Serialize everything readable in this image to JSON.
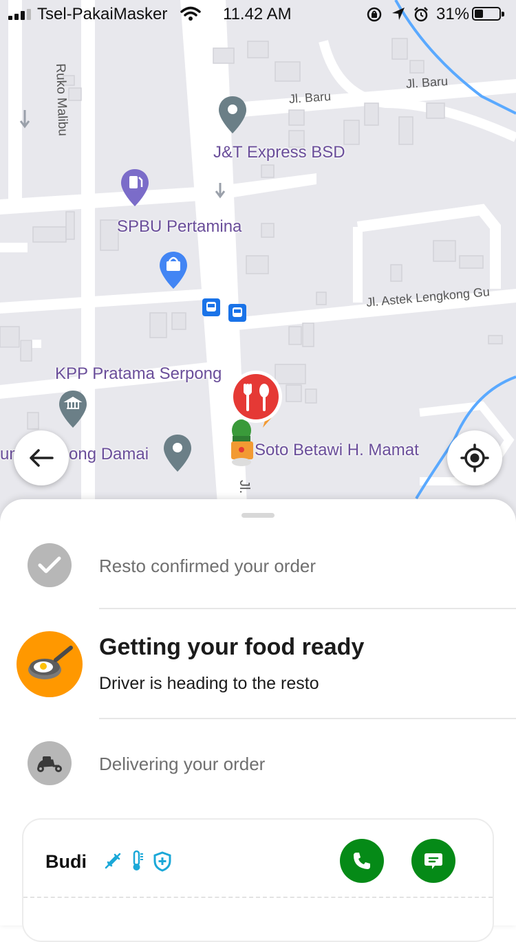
{
  "status_bar": {
    "carrier": "Tsel-PakaiMasker",
    "time": "11.42 AM",
    "battery": "31%"
  },
  "map": {
    "labels": {
      "jnt": "J&T Express BSD",
      "spbu": "SPBU Pertamina",
      "kpp": "KPP Pratama Serpong",
      "soto": "Soto Betawi H. Mamat",
      "damai_left": "um",
      "damai": "ong Damai"
    },
    "roads": {
      "ruko": "Ruko Malibu",
      "baru1": "Jl. Baru",
      "baru2": "Jl. Baru",
      "astek": "Jl. Astek Lengkong Gu",
      "jl": "Jl."
    },
    "colors": {
      "poi_label": "#6a4e9a",
      "pin_grey": "#6b7f87",
      "pin_blue": "#4285f4",
      "resto_red": "#e53935"
    }
  },
  "sheet": {
    "steps": [
      {
        "icon": "check-icon",
        "text": "Resto confirmed your order"
      },
      {
        "icon": "frying-pan-icon",
        "title": "Getting your food ready",
        "subtitle": "Driver is heading to the resto"
      },
      {
        "icon": "scooter-icon",
        "text": "Delivering your order"
      }
    ],
    "driver": {
      "name": "Budi",
      "badges": [
        "vaccine-icon",
        "thermometer-icon",
        "shield-icon"
      ],
      "actions": [
        "call",
        "chat"
      ]
    },
    "colors": {
      "accent_green": "#058a17",
      "badge_blue": "#1ba8d8",
      "active_orange": "#ff9800"
    }
  }
}
